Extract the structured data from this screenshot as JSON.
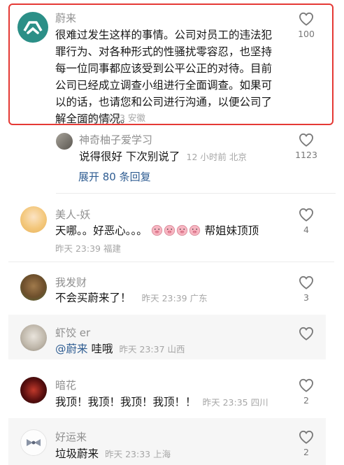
{
  "comments": [
    {
      "name": "蔚来",
      "text": "很难过发生这样的事情。公司对员工的违法犯罪行为、对各种形式的性骚扰零容忍，也坚持每一位同事都应该受到公平公正的对待。目前公司已经成立调查小组进行全面调查。如果可以的话，也请您和公司进行沟通，以便公司了解全面的情况。",
      "time": "昨天 23:43 安徽",
      "likes": "100",
      "highlighted": true
    },
    {
      "name": "神奇柚子爱学习",
      "text": "说得很好 下次别说了",
      "time": "12 小时前 北京",
      "likes": "1123"
    },
    {
      "name": "美人-妖",
      "text_prefix": "天哪。。好恶心。。。",
      "text_suffix": "帮姐妹顶顶",
      "time": "昨天 23:39 福建",
      "likes": "4"
    },
    {
      "name": "我发财",
      "text": "不会买蔚来了！",
      "time": "昨天 23:39 广东",
      "likes": "3"
    },
    {
      "name": "虾饺 er",
      "mention": "@蔚来",
      "text": " 哇哦",
      "time": "昨天 23:37 山西",
      "likes": ""
    },
    {
      "name": "暗花",
      "text": "我顶！我顶！我顶！我顶！！",
      "time": "昨天 23:35 四川",
      "likes": "2"
    },
    {
      "name": "好运来",
      "text": "垃圾蔚来",
      "time": "昨天 23:33 上海",
      "likes": "2"
    }
  ],
  "expand_replies": "展开 80 条回复",
  "icons": {
    "like": "heart-outline-icon",
    "emoji": "pig-face-emoji"
  },
  "colors": {
    "highlight_border": "#e53935",
    "link": "#2f5d92"
  }
}
